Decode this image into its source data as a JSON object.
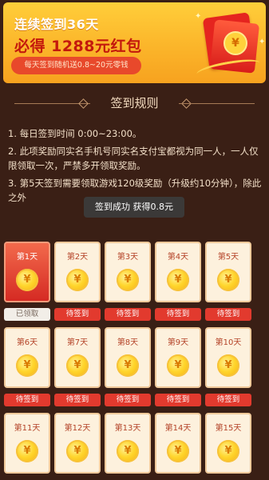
{
  "banner": {
    "line1": "连续签到36天",
    "line2": "必得 1288元红包",
    "pill": "每天签到随机送0.8~20元零钱",
    "coin_symbol": "¥"
  },
  "section": {
    "title": "签到规则"
  },
  "rules": [
    "1. 每日签到时间 0:00~23:00。",
    "2. 此项奖励同实名手机号同实名支付宝都视为同一人，一人仅限领取一次，严禁多开领取奖励。",
    "3. 第5天签到需要领取游戏120级奖励（升级约10分钟），除此之外"
  ],
  "toast": "签到成功 获得0.8元",
  "days": [
    {
      "label": "第1天",
      "status": "已领取",
      "claimed": true
    },
    {
      "label": "第2天",
      "status": "待签到",
      "claimed": false
    },
    {
      "label": "第3天",
      "status": "待签到",
      "claimed": false
    },
    {
      "label": "第4天",
      "status": "待签到",
      "claimed": false
    },
    {
      "label": "第5天",
      "status": "待签到",
      "claimed": false
    },
    {
      "label": "第6天",
      "status": "待签到",
      "claimed": false
    },
    {
      "label": "第7天",
      "status": "待签到",
      "claimed": false
    },
    {
      "label": "第8天",
      "status": "待签到",
      "claimed": false
    },
    {
      "label": "第9天",
      "status": "待签到",
      "claimed": false
    },
    {
      "label": "第10天",
      "status": "待签到",
      "claimed": false
    },
    {
      "label": "第11天",
      "status": "",
      "claimed": false
    },
    {
      "label": "第12天",
      "status": "",
      "claimed": false
    },
    {
      "label": "第13天",
      "status": "",
      "claimed": false
    },
    {
      "label": "第14天",
      "status": "",
      "claimed": false
    },
    {
      "label": "第15天",
      "status": "",
      "claimed": false
    }
  ],
  "coin_symbol": "¥",
  "colors": {
    "background": "#3a1f15",
    "banner": "#fbb52a",
    "accent_red": "#e23a2e",
    "card": "#fdf1dd"
  },
  "icons": [
    "red-envelope-icon",
    "coin-icon",
    "sparkle-icon",
    "diamond-divider-icon"
  ]
}
